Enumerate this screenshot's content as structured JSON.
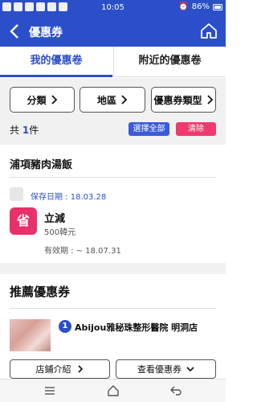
{
  "status_bar": {
    "time": "10:05",
    "battery": "86%"
  },
  "app_bar": {
    "title": "優惠券"
  },
  "tabs": [
    {
      "label": "我的優惠卷"
    },
    {
      "label": "附近的優惠卷"
    }
  ],
  "filters": [
    {
      "label": "分類"
    },
    {
      "label": "地區"
    },
    {
      "label": "優惠券類型"
    }
  ],
  "summary": {
    "prefix": "共",
    "count": "1",
    "suffix": "件",
    "select_all": "選擇全部",
    "clear": "清除"
  },
  "coupon_group": {
    "store": "浦項豬肉湯飯",
    "saved_date": "保存日期 : 18.03.28",
    "icon_char": "省",
    "title": "立減",
    "amount": "500韓元",
    "expiry": "有效期 : ~ 18.07.31"
  },
  "recommended": {
    "title": "推薦優惠券",
    "pin_number": "1",
    "clinic_name": "Abijou雅秘珠整形醫院 明洞店",
    "store_info_button": "店鋪介紹",
    "view_coupons_button": "查看優惠券"
  },
  "colors": {
    "primary": "#2b4fc9",
    "accent": "#ef3a6e",
    "coupon_icon": "#e8316a"
  }
}
